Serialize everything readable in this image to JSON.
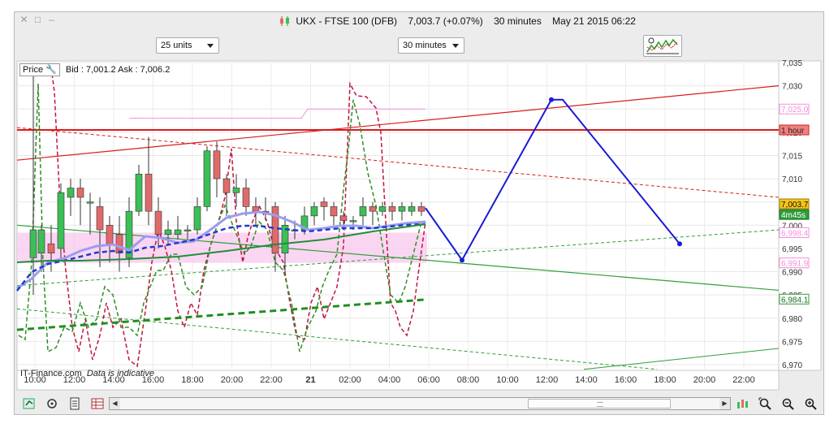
{
  "window": {
    "title_symbol": "UKX - FTSE 100 (DFB)",
    "title_price": "7,003.7 (+0.07%)",
    "title_period": "30 minutes",
    "title_date": "May 21 2015 06:22"
  },
  "toolbar": {
    "units_select": "25 units",
    "interval_select": "30 minutes"
  },
  "chart": {
    "price_button": "Price",
    "bid_ask": "Bid : 7,001.2 Ask : 7,006.2",
    "watermark": "IT-Finance.com",
    "watermark_note": "Data is indicative",
    "y_ticks": [
      "7,035",
      "7,030",
      "7,025",
      "7,020",
      "7,015",
      "7,010",
      "7,005",
      "7,000",
      "6,995",
      "6,990",
      "6,985",
      "6,980",
      "6,975",
      "6,970"
    ],
    "x_ticks": [
      "10:00",
      "12:00",
      "14:00",
      "16:00",
      "18:00",
      "20:00",
      "22:00",
      "21",
      "02:00",
      "04:00",
      "06:00",
      "08:00",
      "10:00",
      "12:00",
      "14:00",
      "16:00",
      "18:00",
      "20:00",
      "22:00"
    ],
    "price_labels": {
      "upper_channel": "7,025.0",
      "hour_line": "1 hour",
      "current": "7,003.7",
      "countdown": "4m45s",
      "band_top": "6,998.4",
      "band_bottom": "6,991.9",
      "lower_ma": "6,984.1"
    },
    "colors": {
      "up_candle": "#3cbf56",
      "down_candle": "#e06a6a",
      "resistance": "#d91c1c",
      "support": "#2e9e3a",
      "projection": "#1a1ad6",
      "band": "#f8c8ef",
      "ma": "#1e3ccc"
    }
  },
  "bottombar": {
    "scroll_grip": "≡"
  }
}
